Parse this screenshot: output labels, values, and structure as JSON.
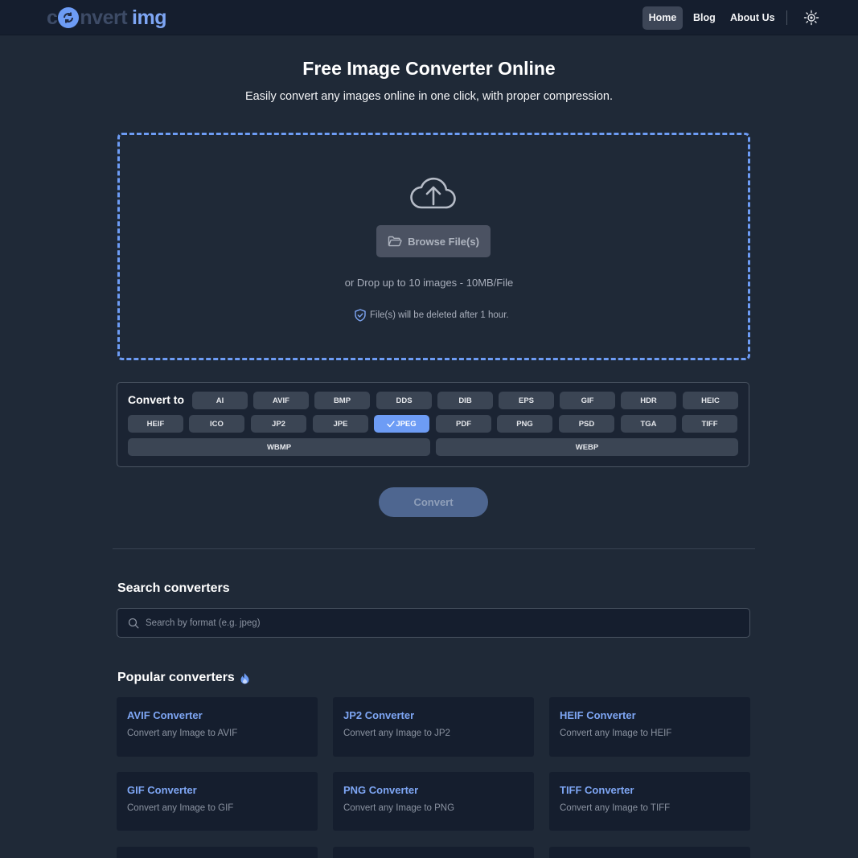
{
  "header": {
    "logo": {
      "part1": "c",
      "part2": "nvert",
      "part3": "img"
    },
    "nav": {
      "home": "Home",
      "blog": "Blog",
      "about": "About Us"
    }
  },
  "hero": {
    "title": "Free Image Converter Online",
    "subtitle": "Easily convert any images online in one click, with proper compression."
  },
  "dropzone": {
    "browse_label": "Browse File(s)",
    "drop_text": "or Drop up to 10 images - 10MB/File",
    "delete_note": "File(s) will be deleted after 1 hour."
  },
  "convert": {
    "label": "Convert to",
    "formats": [
      "AI",
      "AVIF",
      "BMP",
      "DDS",
      "DIB",
      "EPS",
      "GIF",
      "HDR",
      "HEIC",
      "HEIF",
      "ICO",
      "JP2",
      "JPE",
      "JPEG",
      "PDF",
      "PNG",
      "PSD",
      "TGA",
      "TIFF",
      "WBMP",
      "WEBP"
    ],
    "selected": "JPEG",
    "button": "Convert"
  },
  "search": {
    "heading": "Search converters",
    "placeholder": "Search by format (e.g. jpeg)"
  },
  "popular": {
    "heading": "Popular converters",
    "cards": [
      {
        "title": "AVIF Converter",
        "desc": "Convert any Image to AVIF"
      },
      {
        "title": "JP2 Converter",
        "desc": "Convert any Image to JP2"
      },
      {
        "title": "HEIF Converter",
        "desc": "Convert any Image to HEIF"
      },
      {
        "title": "GIF Converter",
        "desc": "Convert any Image to GIF"
      },
      {
        "title": "PNG Converter",
        "desc": "Convert any Image to PNG"
      },
      {
        "title": "TIFF Converter",
        "desc": "Convert any Image to TIFF"
      }
    ]
  },
  "colors": {
    "accent": "#6d9cf5",
    "background": "#1f2937",
    "header": "#151e2e"
  }
}
